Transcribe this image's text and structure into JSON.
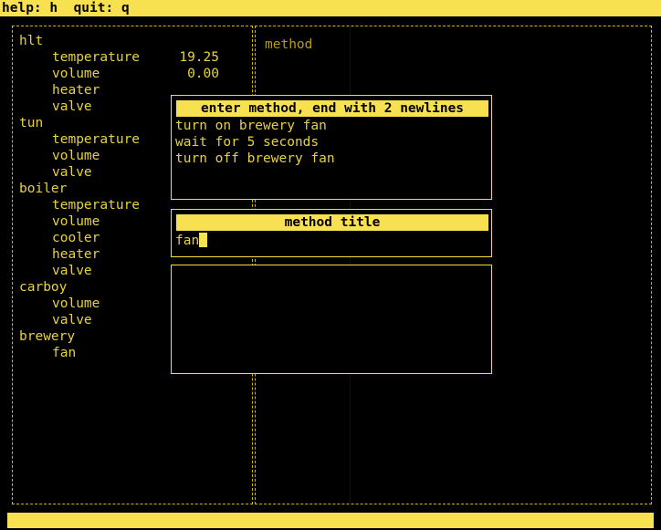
{
  "topbar": {
    "text": "help: h  quit: q"
  },
  "bottombar": {
    "text": ""
  },
  "left_panel": {
    "name": "device-tree",
    "rows": [
      {
        "label": "hlt",
        "level": 0,
        "value": ""
      },
      {
        "label": "temperature",
        "level": 1,
        "value": "19.25"
      },
      {
        "label": "volume",
        "level": 1,
        "value": "0.00"
      },
      {
        "label": "heater",
        "level": 1,
        "value": ""
      },
      {
        "label": "valve",
        "level": 1,
        "value": ""
      },
      {
        "label": "tun",
        "level": 0,
        "value": ""
      },
      {
        "label": "temperature",
        "level": 1,
        "value": ""
      },
      {
        "label": "volume",
        "level": 1,
        "value": ""
      },
      {
        "label": "valve",
        "level": 1,
        "value": ""
      },
      {
        "label": "boiler",
        "level": 0,
        "value": ""
      },
      {
        "label": "temperature",
        "level": 1,
        "value": ""
      },
      {
        "label": "volume",
        "level": 1,
        "value": ""
      },
      {
        "label": "cooler",
        "level": 1,
        "value": ""
      },
      {
        "label": "heater",
        "level": 1,
        "value": ""
      },
      {
        "label": "valve",
        "level": 1,
        "value": ""
      },
      {
        "label": "carboy",
        "level": 0,
        "value": ""
      },
      {
        "label": "volume",
        "level": 1,
        "value": ""
      },
      {
        "label": "valve",
        "level": 1,
        "value": ""
      },
      {
        "label": "brewery",
        "level": 0,
        "value": ""
      },
      {
        "label": "fan",
        "level": 1,
        "value": ""
      }
    ]
  },
  "right_panel": {
    "label": "method"
  },
  "dialogs": {
    "method_entry": {
      "header": "enter method, end with 2 newlines",
      "lines": [
        "turn on brewery fan",
        "wait for 5 seconds",
        "turn off brewery fan"
      ]
    },
    "method_title": {
      "header": "method title",
      "value": "fan"
    },
    "empty_panel": {
      "header": "",
      "value": ""
    }
  },
  "colors": {
    "background": "#000000",
    "accent_bar": "#f7e150",
    "text": "#e8d23c",
    "border": "#d6b800",
    "dim_text": "#b99b13"
  }
}
